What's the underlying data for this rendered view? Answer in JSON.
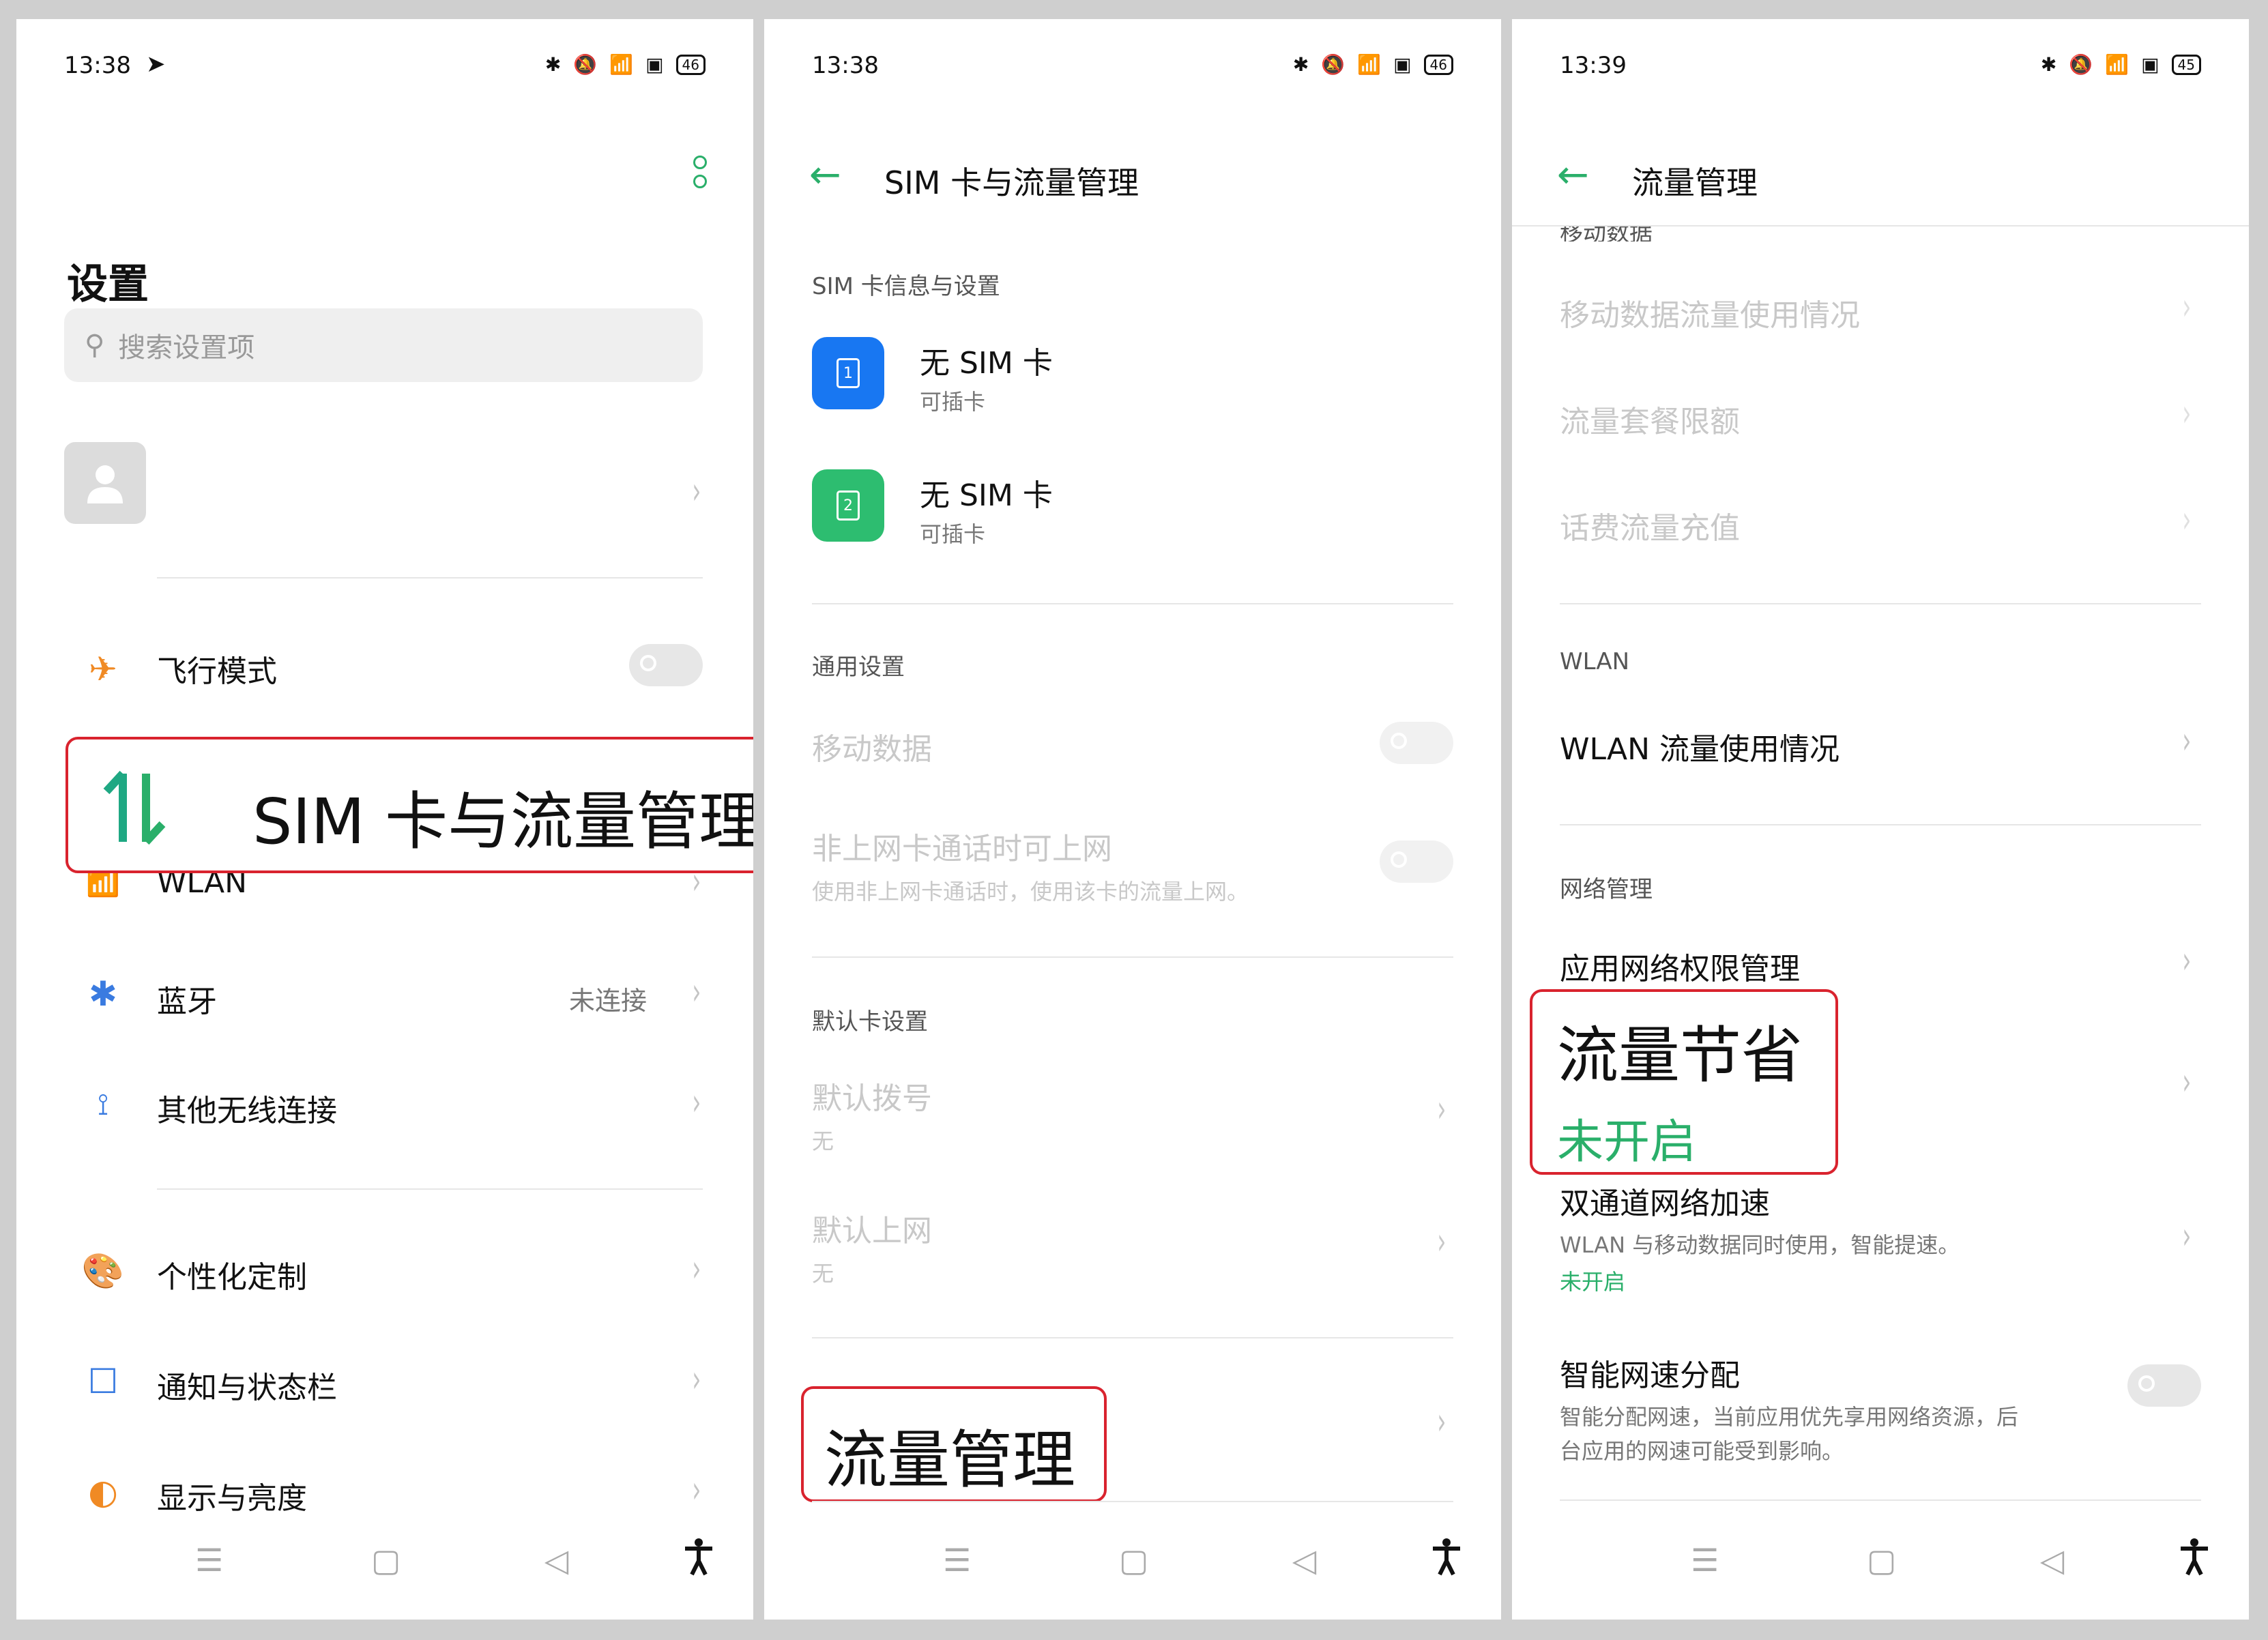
{
  "screen1": {
    "time": "13:38",
    "battery": "46",
    "title": "设置",
    "search_placeholder": "搜索设置项",
    "items": {
      "airplane": "飞行模式",
      "sim": "SIM 卡与流量管理",
      "wlan": "WLAN",
      "bluetooth": "蓝牙",
      "bluetooth_value": "未连接",
      "other_wireless": "其他无线连接",
      "personalize": "个性化定制",
      "notification": "通知与状态栏",
      "display": "显示与亮度"
    }
  },
  "screen2": {
    "time": "13:38",
    "battery": "46",
    "title": "SIM 卡与流量管理",
    "section_sim": "SIM 卡信息与设置",
    "sim1": {
      "title": "无 SIM 卡",
      "subtitle": "可插卡",
      "num": "1"
    },
    "sim2": {
      "title": "无 SIM 卡",
      "subtitle": "可插卡",
      "num": "2"
    },
    "section_general": "通用设置",
    "mobile_data": "移动数据",
    "non_data_call": "非上网卡通话时可上网",
    "non_data_call_sub": "使用非上网卡通话时，使用该卡的流量上网。",
    "section_default": "默认卡设置",
    "default_dial": "默认拨号",
    "default_dial_value": "无",
    "default_data": "默认上网",
    "default_data_value": "无",
    "traffic_manage": "流量管理"
  },
  "screen3": {
    "time": "13:39",
    "battery": "45",
    "title": "流量管理",
    "section_mobile_partial": "移动数据",
    "mobile_usage": "移动数据流量使用情况",
    "plan_limit": "流量套餐限额",
    "recharge": "话费流量充值",
    "section_wlan": "WLAN",
    "wlan_usage": "WLAN 流量使用情况",
    "section_network": "网络管理",
    "app_permission": "应用网络权限管理",
    "data_saver": "流量节省",
    "data_saver_status": "未开启",
    "dual_channel": "双通道网络加速",
    "dual_channel_sub": "WLAN 与移动数据同时使用，智能提速。",
    "dual_channel_status": "未开启",
    "smart_speed": "智能网速分配",
    "smart_speed_sub1": "智能分配网速，当前应用优先享用网络资源，后",
    "smart_speed_sub2": "台应用的网速可能受到影响。"
  },
  "colors": {
    "accent": "#2aaf6a",
    "highlight": "#d9232e",
    "sim1_bg": "#1877f2",
    "sim2_bg": "#2dbd70"
  },
  "icons": {
    "back": "back-arrow-icon",
    "chevron": "chevron-right-icon",
    "nav_menu": "menu-icon",
    "nav_home": "home-icon",
    "nav_back": "back-triangle-icon",
    "nav_accessibility": "accessibility-icon"
  }
}
